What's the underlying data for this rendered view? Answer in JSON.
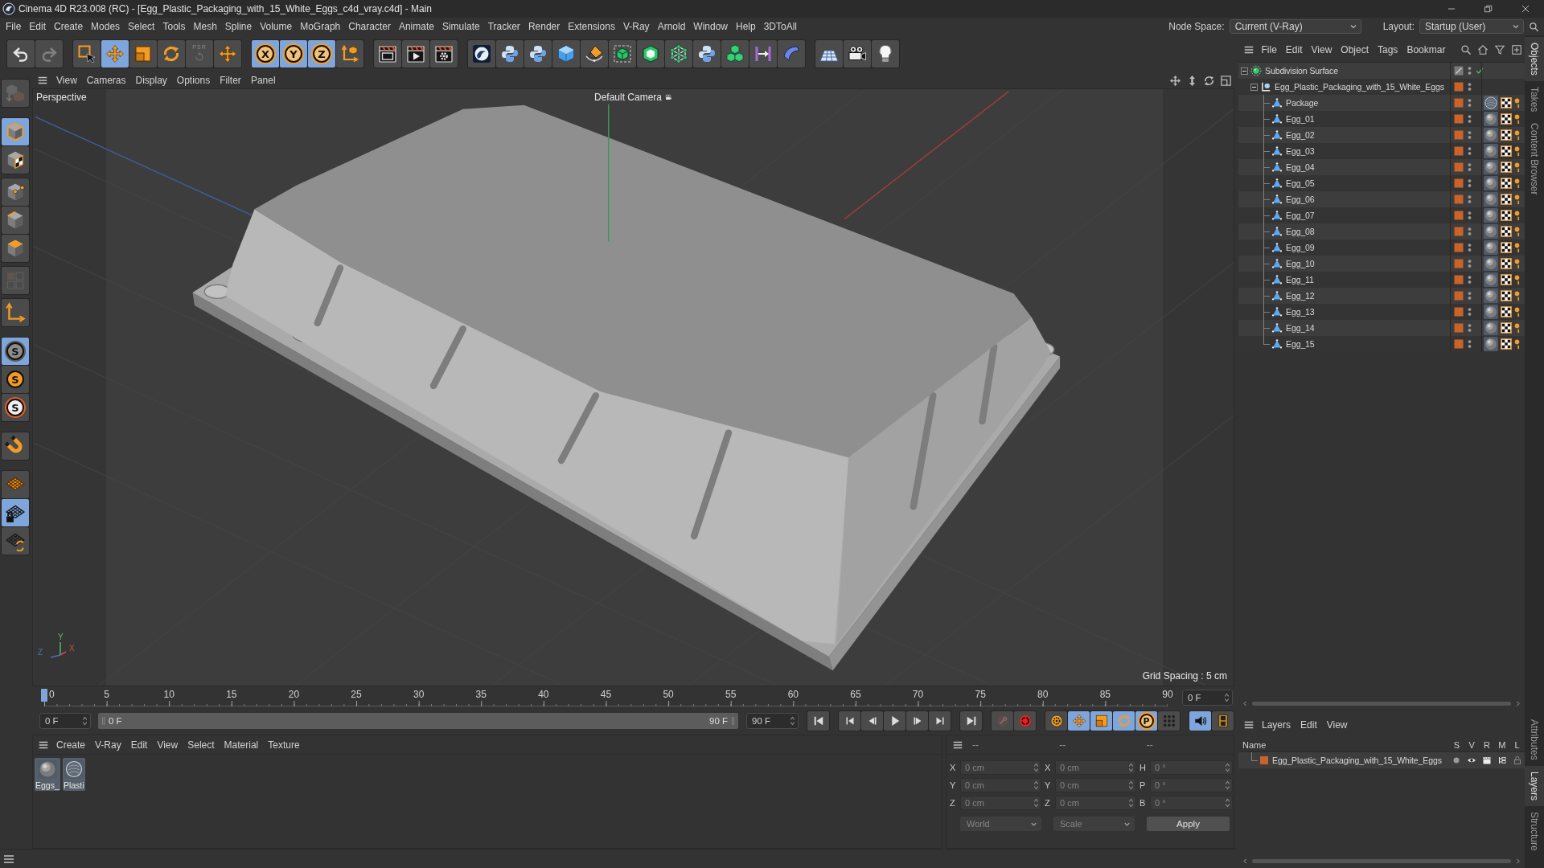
{
  "window": {
    "title": "Cinema 4D R23.008 (RC) - [Egg_Plastic_Packaging_with_15_White_Eggs_c4d_vray.c4d] - Main"
  },
  "menu_bar": {
    "items": [
      "File",
      "Edit",
      "Create",
      "Modes",
      "Select",
      "Tools",
      "Mesh",
      "Spline",
      "Volume",
      "MoGraph",
      "Character",
      "Animate",
      "Simulate",
      "Tracker",
      "Render",
      "Extensions",
      "V-Ray",
      "Arnold",
      "Window",
      "Help",
      "3DToAll"
    ],
    "node_space": {
      "label": "Node Space:",
      "value": "Current (V-Ray)"
    },
    "layout": {
      "label": "Layout:",
      "value": "Startup (User)"
    }
  },
  "toolbar": {
    "groups": [
      [
        {
          "kind": "undo",
          "on": false,
          "disabled": false
        },
        {
          "kind": "redo",
          "on": false,
          "disabled": true
        }
      ],
      [
        {
          "kind": "select",
          "on": false,
          "disabled": false
        },
        {
          "kind": "move",
          "on": true,
          "disabled": false
        },
        {
          "kind": "scale",
          "on": false,
          "disabled": false
        },
        {
          "kind": "rotate",
          "on": false,
          "disabled": false
        },
        {
          "kind": "psr",
          "label": "PSR",
          "on": false,
          "disabled": true
        },
        {
          "kind": "axis",
          "on": false,
          "disabled": false
        }
      ],
      [
        {
          "kind": "lock",
          "label": "X",
          "on": true,
          "disabled": false
        },
        {
          "kind": "lock",
          "label": "Y",
          "on": true,
          "disabled": false
        },
        {
          "kind": "lock",
          "label": "Z",
          "on": true,
          "disabled": false
        },
        {
          "kind": "coords",
          "on": false,
          "disabled": false
        }
      ],
      [
        {
          "kind": "render-view",
          "on": false,
          "disabled": false
        },
        {
          "kind": "render",
          "on": false,
          "disabled": false
        },
        {
          "kind": "render-settings",
          "on": false,
          "disabled": false
        }
      ],
      [
        {
          "kind": "swirl",
          "on": false,
          "disabled": false
        },
        {
          "kind": "python",
          "on": false,
          "disabled": false
        },
        {
          "kind": "python",
          "on": false,
          "disabled": false
        },
        {
          "kind": "cube",
          "on": false,
          "disabled": false
        },
        {
          "kind": "pen",
          "on": false,
          "disabled": false
        },
        {
          "kind": "subdivision",
          "on": false,
          "disabled": false
        },
        {
          "kind": "extrude",
          "on": false,
          "disabled": false
        },
        {
          "kind": "cloner",
          "on": false,
          "disabled": false
        },
        {
          "kind": "python",
          "on": false,
          "disabled": false
        },
        {
          "kind": "cubes",
          "on": false,
          "disabled": false
        },
        {
          "kind": "measure",
          "on": false,
          "disabled": false
        },
        {
          "kind": "bend",
          "on": false,
          "disabled": false
        }
      ],
      [
        {
          "kind": "floor",
          "on": false,
          "disabled": false
        },
        {
          "kind": "camera",
          "on": false,
          "disabled": false
        },
        {
          "kind": "light",
          "on": false,
          "disabled": false
        }
      ]
    ]
  },
  "left_toolbar": {
    "groups": [
      [
        {
          "kind": "make-editable",
          "on": false,
          "disabled": true
        }
      ],
      [
        {
          "kind": "model",
          "on": true,
          "disabled": false
        },
        {
          "kind": "texture",
          "on": false,
          "disabled": false
        }
      ],
      [
        {
          "kind": "points",
          "on": false,
          "disabled": false
        },
        {
          "kind": "edges",
          "on": false,
          "disabled": false
        },
        {
          "kind": "polygons",
          "on": false,
          "disabled": false
        }
      ],
      [
        {
          "kind": "uv",
          "on": false,
          "disabled": true
        }
      ],
      [
        {
          "kind": "axis-mode",
          "on": false,
          "disabled": false
        }
      ],
      [
        {
          "kind": "snap",
          "label": "S",
          "on": true,
          "disabled": false
        },
        {
          "kind": "snap-fill",
          "label": "S",
          "on": false,
          "disabled": false
        },
        {
          "kind": "snap-ring",
          "label": "S",
          "on": false,
          "disabled": false
        }
      ],
      [
        {
          "kind": "magnet",
          "on": false,
          "disabled": false
        }
      ],
      [
        {
          "kind": "workplane",
          "on": false,
          "disabled": false
        },
        {
          "kind": "workplane-lock",
          "on": true,
          "disabled": false
        },
        {
          "kind": "workplane-align",
          "on": false,
          "disabled": false
        }
      ]
    ]
  },
  "viewport": {
    "menu": [
      "View",
      "Cameras",
      "Display",
      "Options",
      "Filter",
      "Panel"
    ],
    "view_name": "Perspective",
    "camera": "Default Camera",
    "grid_spacing": "Grid Spacing : 5 cm",
    "axis_labels": [
      "Z",
      "Y",
      "X"
    ]
  },
  "timeline": {
    "ruler": [
      "0",
      "5",
      "10",
      "15",
      "20",
      "25",
      "30",
      "35",
      "40",
      "45",
      "50",
      "55",
      "60",
      "65",
      "70",
      "75",
      "80",
      "85",
      "90"
    ],
    "playhead": {
      "level": 0
    },
    "current_frame": "0 F",
    "start_field": "0 F",
    "range": {
      "start": "0 F",
      "end": "90 F"
    },
    "end_field": "90 F",
    "transport": [
      [
        {
          "kind": "first"
        }
      ],
      [
        {
          "kind": "prev-key"
        },
        {
          "kind": "prev-frame"
        },
        {
          "kind": "play"
        },
        {
          "kind": "next-frame"
        },
        {
          "kind": "next-key"
        }
      ],
      [
        {
          "kind": "last"
        }
      ],
      [
        {
          "kind": "record",
          "disabled": true
        },
        {
          "kind": "autokey",
          "disabled": false
        }
      ],
      [
        {
          "kind": "key-settings",
          "on": false
        },
        {
          "kind": "move",
          "on": true
        },
        {
          "kind": "scale",
          "on": true
        },
        {
          "kind": "rotate",
          "on": true
        },
        {
          "kind": "point",
          "label": "P",
          "on": true
        },
        {
          "kind": "param",
          "on": false
        }
      ],
      [
        {
          "kind": "sound",
          "on": true
        },
        {
          "kind": "film",
          "on": false
        }
      ]
    ]
  },
  "materials": {
    "menu": [
      "Create",
      "V-Ray",
      "Edit",
      "View",
      "Select",
      "Material",
      "Texture"
    ],
    "items": [
      {
        "name": "Eggs_",
        "kind": "solid"
      },
      {
        "name": "Plasti",
        "kind": "clear"
      }
    ]
  },
  "coordinates": {
    "disabled": true,
    "headers": [
      "--",
      "--",
      "--"
    ],
    "rows": [
      [
        {
          "label": "X",
          "value": "0 cm"
        },
        {
          "label": "X",
          "value": "0 cm"
        },
        {
          "label": "H",
          "value": "0 °"
        }
      ],
      [
        {
          "label": "Y",
          "value": "0 cm"
        },
        {
          "label": "Y",
          "value": "0 cm"
        },
        {
          "label": "P",
          "value": "0 °"
        }
      ],
      [
        {
          "label": "Z",
          "value": "0 cm"
        },
        {
          "label": "Z",
          "value": "0 cm"
        },
        {
          "label": "B",
          "value": "0 °"
        }
      ]
    ],
    "mode": "World",
    "transform": "Scale",
    "apply": "Apply"
  },
  "objects": {
    "menu": [
      "File",
      "Edit",
      "View",
      "Object",
      "Tags",
      "Bookmar"
    ],
    "tree": [
      {
        "name": "Subdivision Surface",
        "kind": "subdivision",
        "expanded": true,
        "layer": false,
        "enabled": true,
        "children": [
          {
            "name": "Egg_Plastic_Packaging_with_15_White_Eggs",
            "kind": "null",
            "expanded": true,
            "layer": true,
            "children": [
              {
                "name": "Package",
                "kind": "polygon",
                "layer": true,
                "tag": {
                  "kind": "clear"
                }
              },
              {
                "name": "Egg_01",
                "kind": "polygon",
                "layer": true,
                "tag": {
                  "kind": "solid"
                }
              },
              {
                "name": "Egg_02",
                "kind": "polygon",
                "layer": true,
                "tag": {
                  "kind": "solid"
                }
              },
              {
                "name": "Egg_03",
                "kind": "polygon",
                "layer": true,
                "tag": {
                  "kind": "solid"
                }
              },
              {
                "name": "Egg_04",
                "kind": "polygon",
                "layer": true,
                "tag": {
                  "kind": "solid"
                }
              },
              {
                "name": "Egg_05",
                "kind": "polygon",
                "layer": true,
                "tag": {
                  "kind": "solid"
                }
              },
              {
                "name": "Egg_06",
                "kind": "polygon",
                "layer": true,
                "tag": {
                  "kind": "solid"
                }
              },
              {
                "name": "Egg_07",
                "kind": "polygon",
                "layer": true,
                "tag": {
                  "kind": "solid"
                }
              },
              {
                "name": "Egg_08",
                "kind": "polygon",
                "layer": true,
                "tag": {
                  "kind": "solid"
                }
              },
              {
                "name": "Egg_09",
                "kind": "polygon",
                "layer": true,
                "tag": {
                  "kind": "solid"
                }
              },
              {
                "name": "Egg_10",
                "kind": "polygon",
                "layer": true,
                "tag": {
                  "kind": "solid"
                }
              },
              {
                "name": "Egg_11",
                "kind": "polygon",
                "layer": true,
                "tag": {
                  "kind": "solid"
                }
              },
              {
                "name": "Egg_12",
                "kind": "polygon",
                "layer": true,
                "tag": {
                  "kind": "solid"
                }
              },
              {
                "name": "Egg_13",
                "kind": "polygon",
                "layer": true,
                "tag": {
                  "kind": "solid"
                }
              },
              {
                "name": "Egg_14",
                "kind": "polygon",
                "layer": true,
                "tag": {
                  "kind": "solid"
                }
              },
              {
                "name": "Egg_15",
                "kind": "polygon",
                "layer": true,
                "tag": {
                  "kind": "solid"
                }
              }
            ]
          }
        ]
      }
    ]
  },
  "layers": {
    "menu": [
      "Layers",
      "Edit",
      "View"
    ],
    "columns": [
      "Name",
      "S",
      "V",
      "R",
      "M",
      "L"
    ],
    "rows": [
      {
        "name": "Egg_Plastic_Packaging_with_15_White_Eggs",
        "color": "#c8642a",
        "solo": false,
        "visible": true,
        "render": true,
        "manager": true,
        "locked": false
      }
    ]
  },
  "side_tabs": {
    "top": [
      {
        "label": "Objects",
        "selected": true
      },
      {
        "label": "Takes",
        "selected": false
      },
      {
        "label": "Content Browser",
        "selected": false
      }
    ],
    "bottom": [
      {
        "label": "Attributes",
        "selected": false
      },
      {
        "label": "Layers",
        "selected": true
      },
      {
        "label": "Structure",
        "selected": false
      }
    ]
  }
}
